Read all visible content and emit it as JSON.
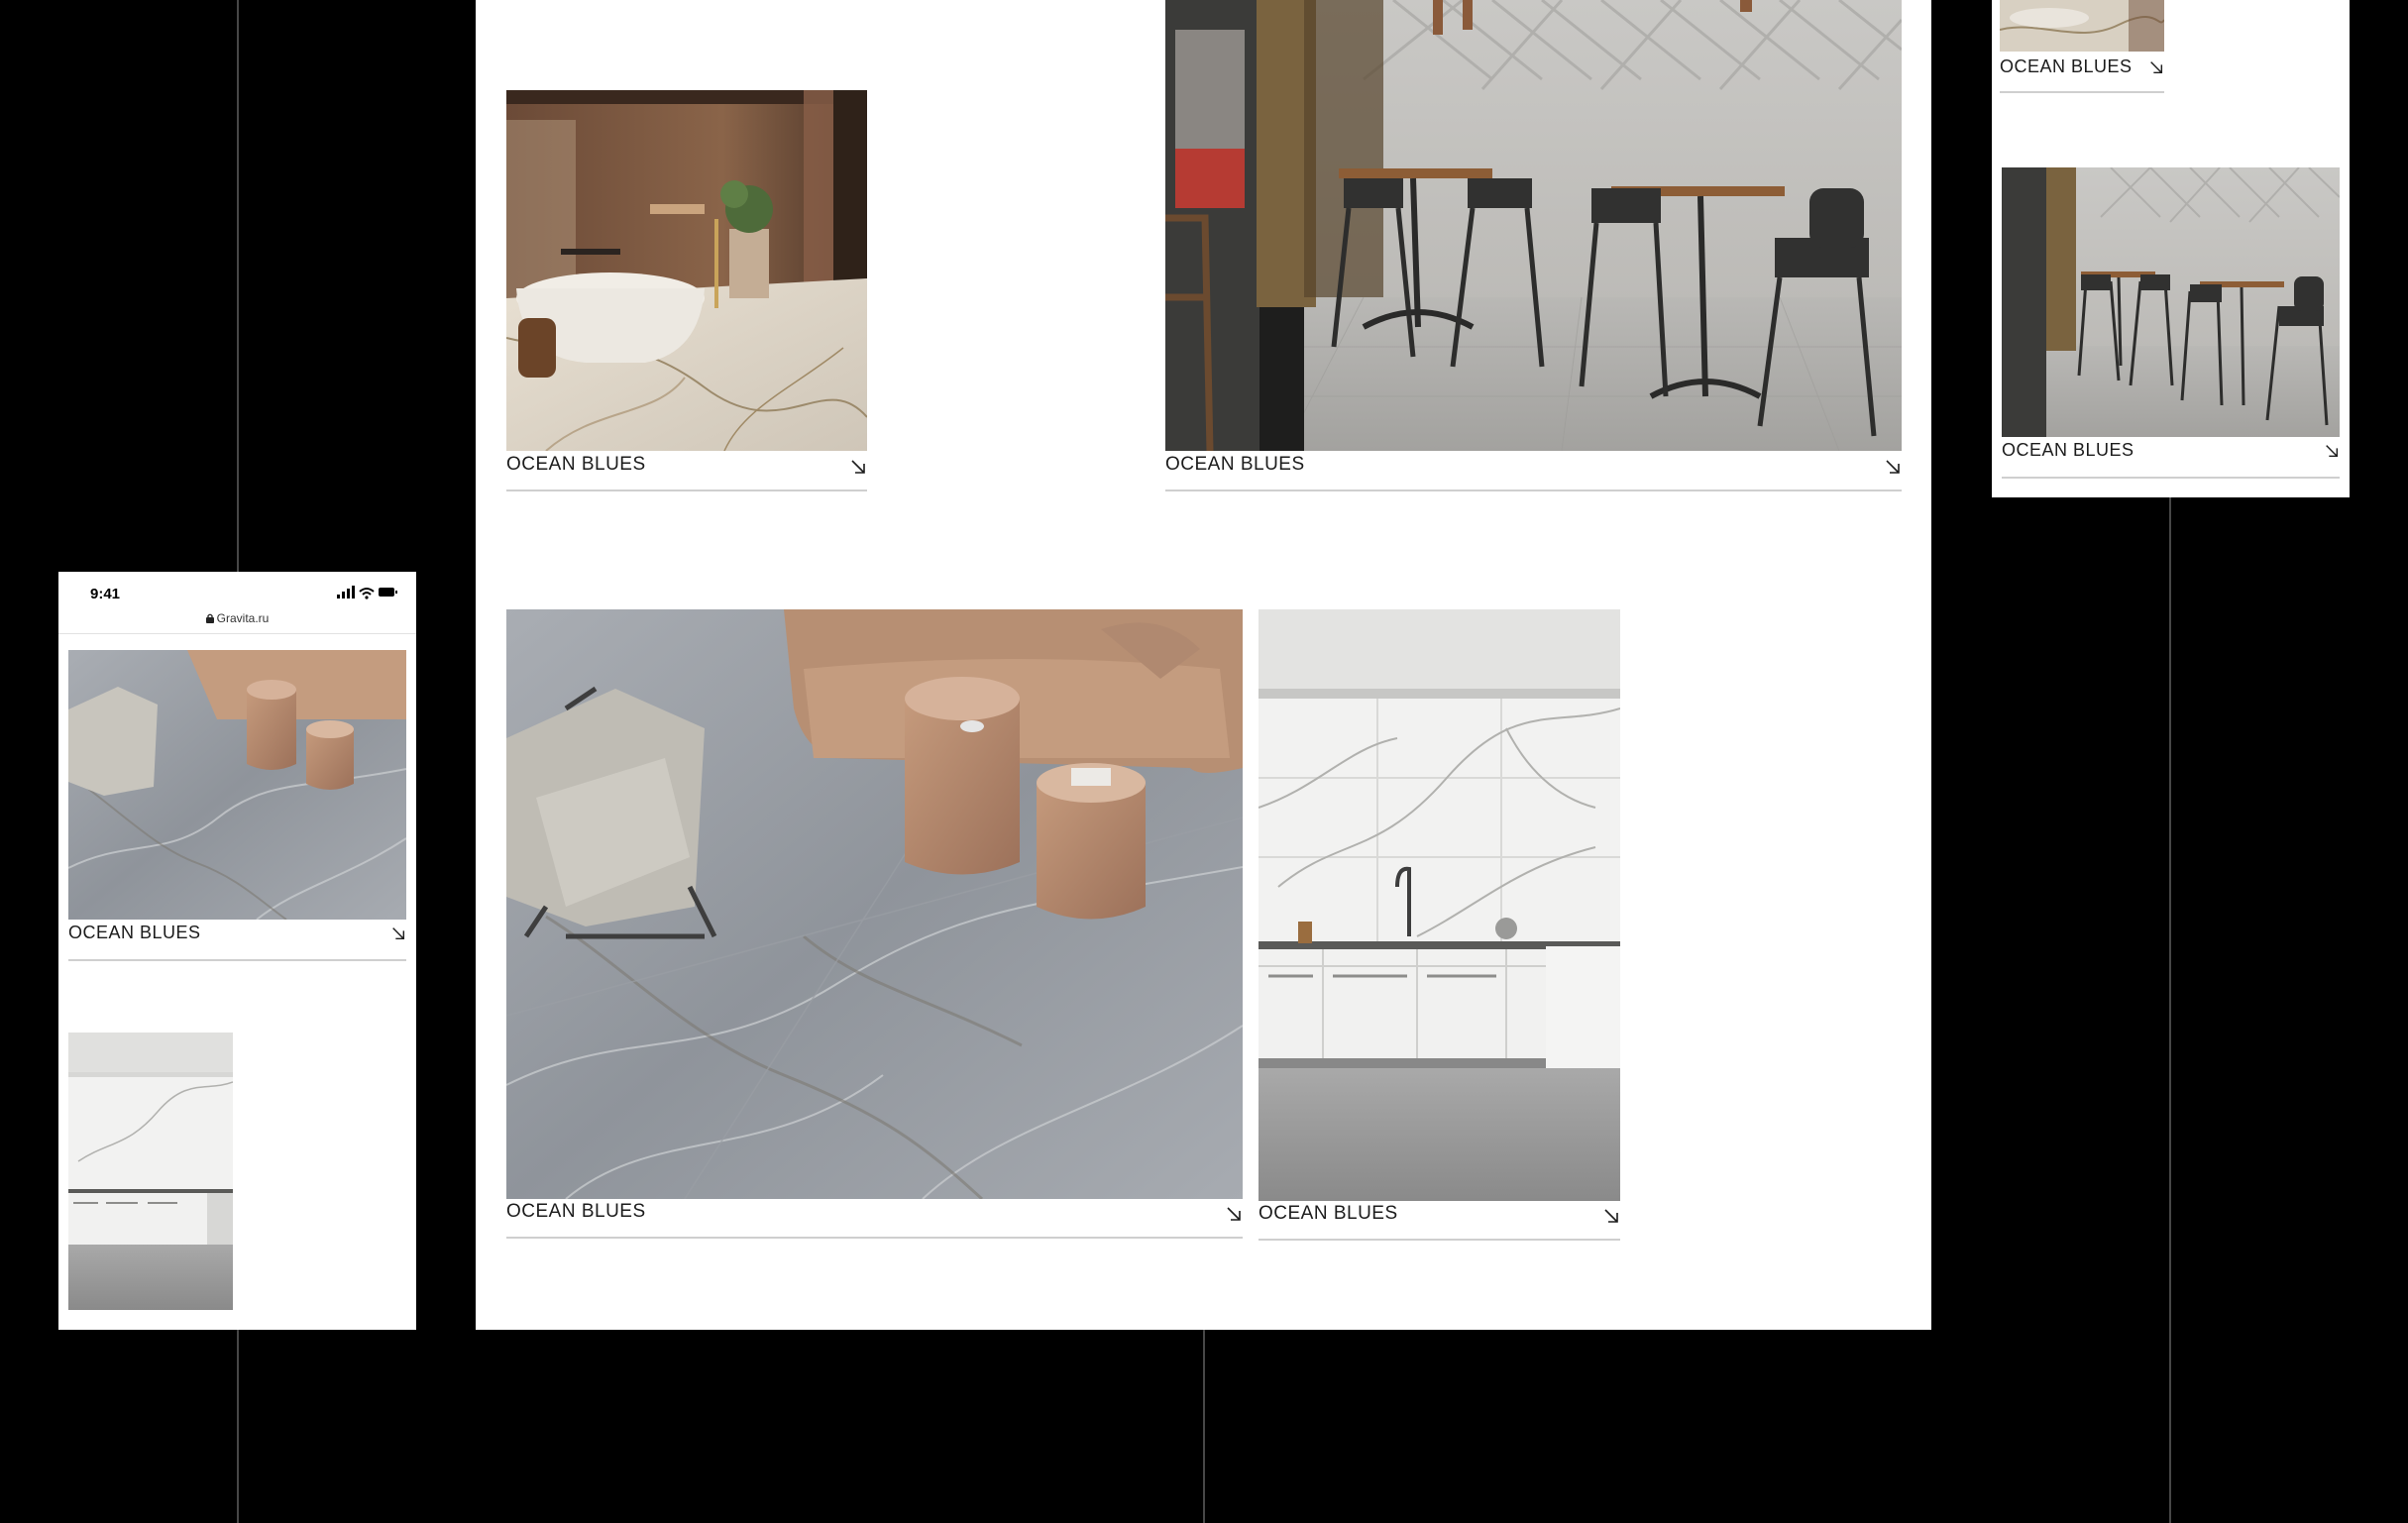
{
  "colors": {
    "background": "#000000",
    "panel": "#ffffff",
    "guide_line": "#474747",
    "caption_text": "#1c1c1c",
    "caption_rule": "#cfcfcf"
  },
  "phone": {
    "time": "9:41",
    "url": "Gravita.ru",
    "lock_icon": "lock-icon"
  },
  "cards": {
    "bathroom": {
      "label": "OCEAN BLUES",
      "icon": "arrow-down-right-icon"
    },
    "cafe": {
      "label": "OCEAN BLUES",
      "icon": "arrow-down-right-icon"
    },
    "living": {
      "label": "OCEAN BLUES",
      "icon": "arrow-down-right-icon"
    },
    "kitchen": {
      "label": "OCEAN BLUES",
      "icon": "arrow-down-right-icon"
    },
    "phone_living": {
      "label": "OCEAN BLUES",
      "icon": "arrow-down-right-icon"
    },
    "right_top": {
      "label": "OCEAN BLUES",
      "icon": "arrow-down-right-icon"
    },
    "right_cafe": {
      "label": "OCEAN BLUES",
      "icon": "arrow-down-right-icon"
    }
  }
}
